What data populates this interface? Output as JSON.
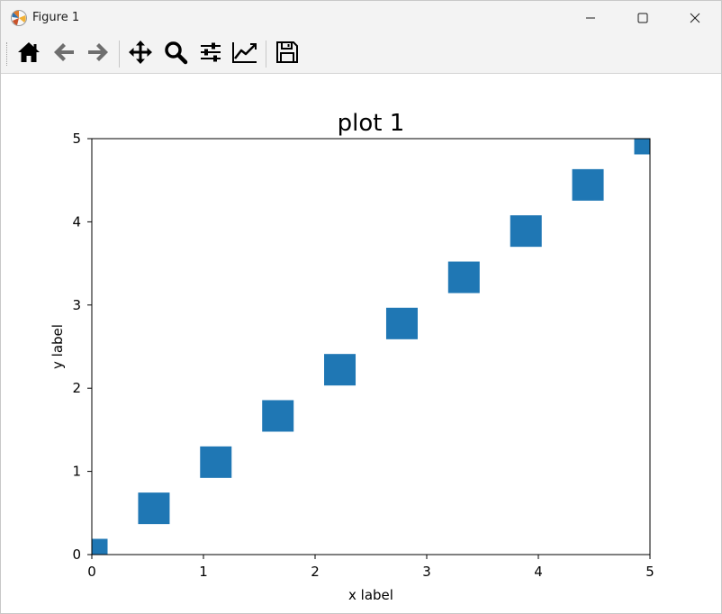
{
  "window": {
    "title": "Figure 1"
  },
  "toolbar": {
    "buttons": [
      {
        "name": "home",
        "icon": "home-icon"
      },
      {
        "name": "back",
        "icon": "arrow-left-icon"
      },
      {
        "name": "forward",
        "icon": "arrow-right-icon"
      },
      {
        "name": "pan",
        "icon": "move-icon"
      },
      {
        "name": "zoom",
        "icon": "magnifier-icon"
      },
      {
        "name": "configure-subplots",
        "icon": "sliders-icon"
      },
      {
        "name": "edit-axis",
        "icon": "line-chart-icon"
      },
      {
        "name": "save",
        "icon": "floppy-disk-icon"
      }
    ]
  },
  "colors": {
    "marker": "#1f77b4",
    "titlebar": "#f3f3f3"
  },
  "chart_data": {
    "type": "scatter",
    "title": "plot 1",
    "xlabel": "x label",
    "ylabel": "y label",
    "xlim": [
      0,
      5
    ],
    "ylim": [
      0,
      5
    ],
    "xticks": [
      "0",
      "1",
      "2",
      "3",
      "4",
      "5"
    ],
    "yticks": [
      "0",
      "1",
      "2",
      "3",
      "4",
      "5"
    ],
    "marker": "square",
    "grid": false,
    "series": [
      {
        "x": [
          0.0,
          0.556,
          1.111,
          1.667,
          2.222,
          2.778,
          3.333,
          3.889,
          4.444,
          5.0
        ],
        "y": [
          0.0,
          0.556,
          1.111,
          1.667,
          2.222,
          2.778,
          3.333,
          3.889,
          4.444,
          5.0
        ]
      }
    ]
  }
}
